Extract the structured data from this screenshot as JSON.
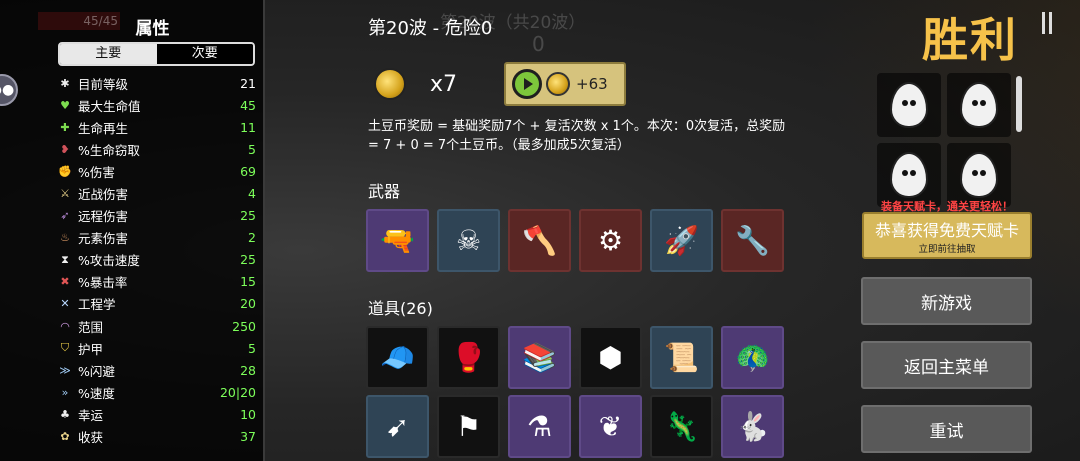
{
  "stats_panel": {
    "hp_text": "45/45",
    "title": "属性",
    "tabs": [
      "主要",
      "次要"
    ],
    "rows": [
      {
        "label": "目前等级",
        "value": "21",
        "icon": "level-icon",
        "glyph": "✱",
        "color": "#ffffff",
        "icon_color": "#eeeeee"
      },
      {
        "label": "最大生命值",
        "value": "45",
        "icon": "heart-icon",
        "glyph": "♥",
        "color": "#7dff5a",
        "icon_color": "#7ddc4f"
      },
      {
        "label": "生命再生",
        "value": "11",
        "icon": "regen-icon",
        "glyph": "✚",
        "color": "#7dff5a",
        "icon_color": "#7ddc4f"
      },
      {
        "label": "%生命窃取",
        "value": "5",
        "icon": "lifesteal-icon",
        "glyph": "❥",
        "color": "#7dff5a",
        "icon_color": "#d0525a"
      },
      {
        "label": "%伤害",
        "value": "69",
        "icon": "damage-icon",
        "glyph": "✊",
        "color": "#7dff5a",
        "icon_color": "#e06b6b"
      },
      {
        "label": "近战伤害",
        "value": "4",
        "icon": "melee-icon",
        "glyph": "⚔",
        "color": "#7dff5a",
        "icon_color": "#e8d28a"
      },
      {
        "label": "远程伤害",
        "value": "25",
        "icon": "ranged-icon",
        "glyph": "➶",
        "color": "#7dff5a",
        "icon_color": "#b88ad8"
      },
      {
        "label": "元素伤害",
        "value": "2",
        "icon": "elemental-icon",
        "glyph": "♨",
        "color": "#7dff5a",
        "icon_color": "#e8a26b"
      },
      {
        "label": "%攻击速度",
        "value": "25",
        "icon": "attack-speed-icon",
        "glyph": "⧗",
        "color": "#7dff5a",
        "icon_color": "#eeeeee"
      },
      {
        "label": "%暴击率",
        "value": "15",
        "icon": "crit-icon",
        "glyph": "✖",
        "color": "#7dff5a",
        "icon_color": "#e05555"
      },
      {
        "label": "工程学",
        "value": "20",
        "icon": "engineering-icon",
        "glyph": "✕",
        "color": "#7dff5a",
        "icon_color": "#b8d8ff"
      },
      {
        "label": "范围",
        "value": "250",
        "icon": "range-icon",
        "glyph": "◠",
        "color": "#7dff5a",
        "icon_color": "#d4a0e8"
      },
      {
        "label": "护甲",
        "value": "5",
        "icon": "armor-icon",
        "glyph": "⛉",
        "color": "#7dff5a",
        "icon_color": "#f2d34a"
      },
      {
        "label": "%闪避",
        "value": "28",
        "icon": "dodge-icon",
        "glyph": "≫",
        "color": "#7dff5a",
        "icon_color": "#9ec8f0"
      },
      {
        "label": "%速度",
        "value": "20|20",
        "icon": "speed-icon",
        "glyph": "»",
        "color": "#7dff5a",
        "icon_color": "#9ec8f0"
      },
      {
        "label": "幸运",
        "value": "10",
        "icon": "luck-icon",
        "glyph": "♣",
        "color": "#7dff5a",
        "icon_color": "#eeeeee"
      },
      {
        "label": "收获",
        "value": "37",
        "icon": "harvest-icon",
        "glyph": "✿",
        "color": "#7dff5a",
        "icon_color": "#e8d28a"
      }
    ]
  },
  "center": {
    "ghost_wave_text": "第20波（共20波）",
    "ghost_wave_number": "0",
    "wave_title": "第20波 - 危险0",
    "coin_count": "x7",
    "reward_amount": "+63",
    "description": "土豆币奖励 = 基础奖励7个 + 复活次数 x 1个。本次：0次复活，总奖励 = 7 + 0 = 7个土豆币。（最多加成5次复活）",
    "weapons_title": "武器",
    "weapons": [
      {
        "name": "weapon-yellow-gun-icon",
        "tier": "purple",
        "glyph": "🔫"
      },
      {
        "name": "weapon-skull-wand-icon",
        "tier": "blue",
        "glyph": "☠"
      },
      {
        "name": "weapon-axe-gun-icon",
        "tier": "red",
        "glyph": "🪓"
      },
      {
        "name": "weapon-minigun-icon",
        "tier": "red",
        "glyph": "⚙"
      },
      {
        "name": "weapon-rocket-launcher-icon",
        "tier": "blue",
        "glyph": "🚀"
      },
      {
        "name": "weapon-nail-gun-icon",
        "tier": "red",
        "glyph": "🔧"
      }
    ],
    "items_title": "道具(26)",
    "items_row1": [
      {
        "name": "item-propeller-hat-icon",
        "tier": "black",
        "glyph": "🧢"
      },
      {
        "name": "item-boxing-glove-icon",
        "tier": "black",
        "glyph": "🥊"
      },
      {
        "name": "item-books-icon",
        "tier": "purple",
        "glyph": "📚"
      },
      {
        "name": "item-rock-icon",
        "tier": "black",
        "glyph": "⬢"
      },
      {
        "name": "item-scroll-icon",
        "tier": "blue",
        "glyph": "📜"
      },
      {
        "name": "item-peacock-icon",
        "tier": "purple",
        "glyph": "🦚"
      }
    ],
    "items_row2": [
      {
        "name": "item-claw-icon",
        "tier": "blue",
        "glyph": "➹"
      },
      {
        "name": "item-white-flag-icon",
        "tier": "black",
        "glyph": "⚑"
      },
      {
        "name": "item-potion-icon",
        "tier": "purple",
        "glyph": "⚗"
      },
      {
        "name": "item-wings-icon",
        "tier": "purple",
        "glyph": "❦"
      },
      {
        "name": "item-lizard-icon",
        "tier": "black",
        "glyph": "🦎"
      },
      {
        "name": "item-rabbit-icon",
        "tier": "purple",
        "glyph": "🐇"
      }
    ]
  },
  "right_panel": {
    "victory": "胜利",
    "characters": [
      {
        "name": "character-egg-scarf"
      },
      {
        "name": "character-egg-mustache"
      },
      {
        "name": "character-egg-sad"
      },
      {
        "name": "character-egg-sick"
      }
    ],
    "talent_note": "装备天赋卡，通关更轻松！",
    "talent_main": "恭喜获得免费天赋卡",
    "talent_sub": "立即前往抽取",
    "new_game": "新游戏",
    "main_menu": "返回主菜单",
    "retry": "重试"
  }
}
